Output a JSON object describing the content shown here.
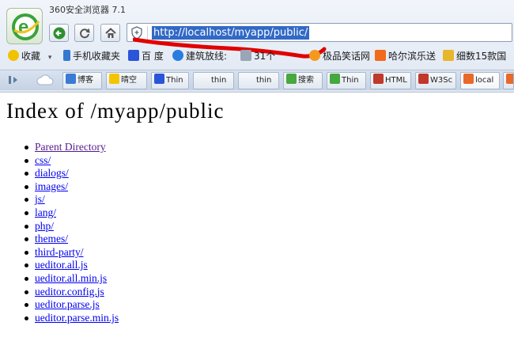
{
  "window": {
    "title": "360安全浏览器 7.1"
  },
  "toolbar": {
    "back": "back",
    "refresh": "refresh",
    "home": "home"
  },
  "address": {
    "url": "http://localhost/myapp/public/"
  },
  "bookmarks": [
    {
      "label": "收藏",
      "icon": "favorites-star-icon"
    },
    {
      "label": "手机收藏夹",
      "icon": "phone-icon"
    },
    {
      "label": "百 度",
      "icon": "baidu-paw-icon"
    },
    {
      "label": "建筑放线:",
      "icon": "video-icon"
    },
    {
      "label": "31个",
      "icon": "generic-icon"
    },
    {
      "label": "极品笑话网",
      "icon": "smile-icon"
    },
    {
      "label": "哈尔滨乐送",
      "icon": "orange-icon"
    },
    {
      "label": "细数15款国",
      "icon": "map-icon"
    }
  ],
  "tabs": [
    {
      "label": "博客",
      "icon": "blog-icon"
    },
    {
      "label": "晴空",
      "icon": "sun-icon"
    },
    {
      "label": "Thin",
      "icon": "baidu-paw-icon"
    },
    {
      "label": "thin",
      "icon": "blank-icon"
    },
    {
      "label": "thin",
      "icon": "blank-icon"
    },
    {
      "label": "搜索",
      "icon": "leaf-icon"
    },
    {
      "label": "Thin",
      "icon": "leaf-icon"
    },
    {
      "label": "HTML",
      "icon": "w3-icon"
    },
    {
      "label": "W3Sc",
      "icon": "w3-icon"
    },
    {
      "label": "local",
      "icon": "fox-icon"
    },
    {
      "label": "",
      "icon": "fox-icon"
    }
  ],
  "page": {
    "title": "Index of /myapp/public",
    "entries": [
      "Parent Directory",
      "css/",
      "dialogs/",
      "images/",
      "js/",
      "lang/",
      "php/",
      "themes/",
      "third-party/",
      "ueditor.all.js",
      "ueditor.all.min.js",
      "ueditor.config.js",
      "ueditor.parse.js",
      "ueditor.parse.min.js"
    ]
  },
  "colors": {
    "link": "#0000ee",
    "visited": "#551a8b",
    "selection": "#3169c6",
    "annotation": "#e00000",
    "brand": "#3aa33a"
  }
}
